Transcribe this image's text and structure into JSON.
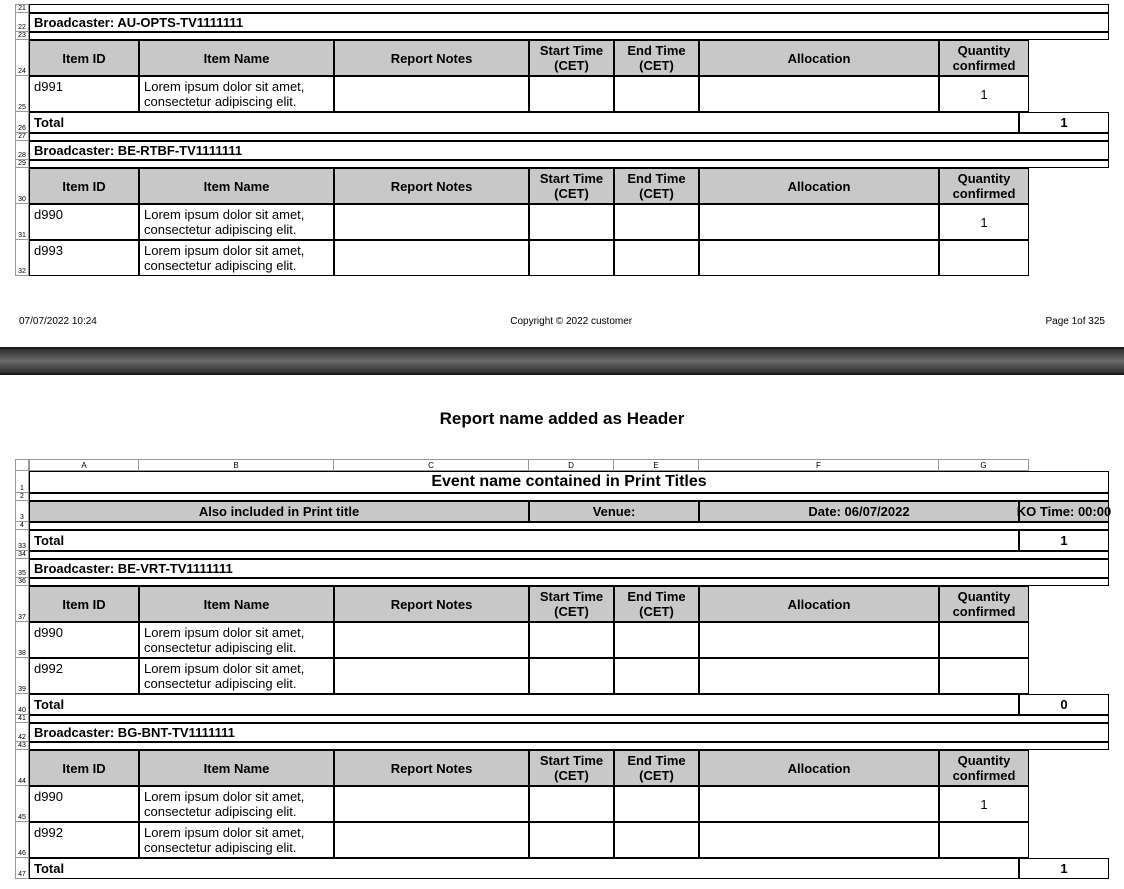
{
  "page1": {
    "footer": {
      "left": "07/07/2022 10:24",
      "center": "Copyright © 2022 customer",
      "right": "Page 1of 325"
    },
    "broadcasters": [
      {
        "rows_before": [
          "21",
          "22",
          "23",
          "24"
        ],
        "label_row": "22",
        "label": "Broadcaster: AU-OPTS-TV1111111",
        "header_rownum": "24",
        "headers": [
          "Item ID",
          "Item Name",
          "Report Notes",
          "Start Time (CET)",
          "End Time (CET)",
          "Allocation",
          "Quantity confirmed"
        ],
        "data_rows": [
          {
            "rownum": "25",
            "item_id": "d991",
            "item_name": "Lorem ipsum dolor sit amet, consectetur adipiscing elit.",
            "report_notes": "",
            "start": "",
            "end": "",
            "alloc": "",
            "qty": "1"
          }
        ],
        "total_rownum": "26",
        "total_label": "Total",
        "total_qty": "1",
        "after_rownum": "27"
      },
      {
        "rows_before": [
          "28",
          "29"
        ],
        "label_row": "28",
        "label": "Broadcaster: BE-RTBF-TV1111111",
        "header_rownum": "30",
        "headers": [
          "Item ID",
          "Item Name",
          "Report Notes",
          "Start Time (CET)",
          "End Time (CET)",
          "Allocation",
          "Quantity confirmed"
        ],
        "data_rows": [
          {
            "rownum": "31",
            "item_id": "d990",
            "item_name": "Lorem ipsum dolor sit amet, consectetur adipiscing elit.",
            "report_notes": "",
            "start": "",
            "end": "",
            "alloc": "",
            "qty": "1"
          },
          {
            "rownum": "32",
            "item_id": "d993",
            "item_name": "Lorem ipsum dolor sit amet, consectetur adipiscing elit.",
            "report_notes": "",
            "start": "",
            "end": "",
            "alloc": "",
            "qty": ""
          }
        ]
      }
    ]
  },
  "page2": {
    "report_header": "Report name added as Header",
    "column_letters": [
      "A",
      "B",
      "C",
      "D",
      "E",
      "F",
      "G"
    ],
    "title_row_num": "1",
    "print_title": "Event name contained in Print Titles",
    "blank_after_title_row": "2",
    "subheader_rownum": "3",
    "subheader": {
      "left": "Also included in Print title",
      "venue": "Venue:",
      "date": "Date: 06/07/2022",
      "ko": "KO Time: 00:00"
    },
    "blank_after_sub_row": "4",
    "carry_total": {
      "rownum": "33",
      "label": "Total",
      "qty": "1"
    },
    "after_carry_row": "34",
    "broadcasters": [
      {
        "label_row": "35",
        "after_label_row": "36",
        "label": "Broadcaster: BE-VRT-TV1111111",
        "header_rownum": "37",
        "headers": [
          "Item ID",
          "Item Name",
          "Report Notes",
          "Start Time (CET)",
          "End Time (CET)",
          "Allocation",
          "Quantity confirmed"
        ],
        "data_rows": [
          {
            "rownum": "38",
            "item_id": "d990",
            "item_name": "Lorem ipsum dolor sit amet, consectetur adipiscing elit.",
            "report_notes": "",
            "start": "",
            "end": "",
            "alloc": "",
            "qty": ""
          },
          {
            "rownum": "39",
            "item_id": "d992",
            "item_name": "Lorem ipsum dolor sit amet, consectetur adipiscing elit.",
            "report_notes": "",
            "start": "",
            "end": "",
            "alloc": "",
            "qty": ""
          }
        ],
        "total_rownum": "40",
        "total_label": "Total",
        "total_qty": "0",
        "after_total_row": "41"
      },
      {
        "label_row": "42",
        "after_label_row": "43",
        "label": "Broadcaster: BG-BNT-TV1111111",
        "header_rownum": "44",
        "headers": [
          "Item ID",
          "Item Name",
          "Report Notes",
          "Start Time (CET)",
          "End Time (CET)",
          "Allocation",
          "Quantity confirmed"
        ],
        "data_rows": [
          {
            "rownum": "45",
            "item_id": "d990",
            "item_name": "Lorem ipsum dolor sit amet, consectetur adipiscing elit.",
            "report_notes": "",
            "start": "",
            "end": "",
            "alloc": "",
            "qty": "1"
          },
          {
            "rownum": "46",
            "item_id": "d992",
            "item_name": "Lorem ipsum dolor sit amet, consectetur adipiscing elit.",
            "report_notes": "",
            "start": "",
            "end": "",
            "alloc": "",
            "qty": ""
          }
        ],
        "total_rownum": "47",
        "total_label": "Total",
        "total_qty": "1"
      }
    ]
  }
}
